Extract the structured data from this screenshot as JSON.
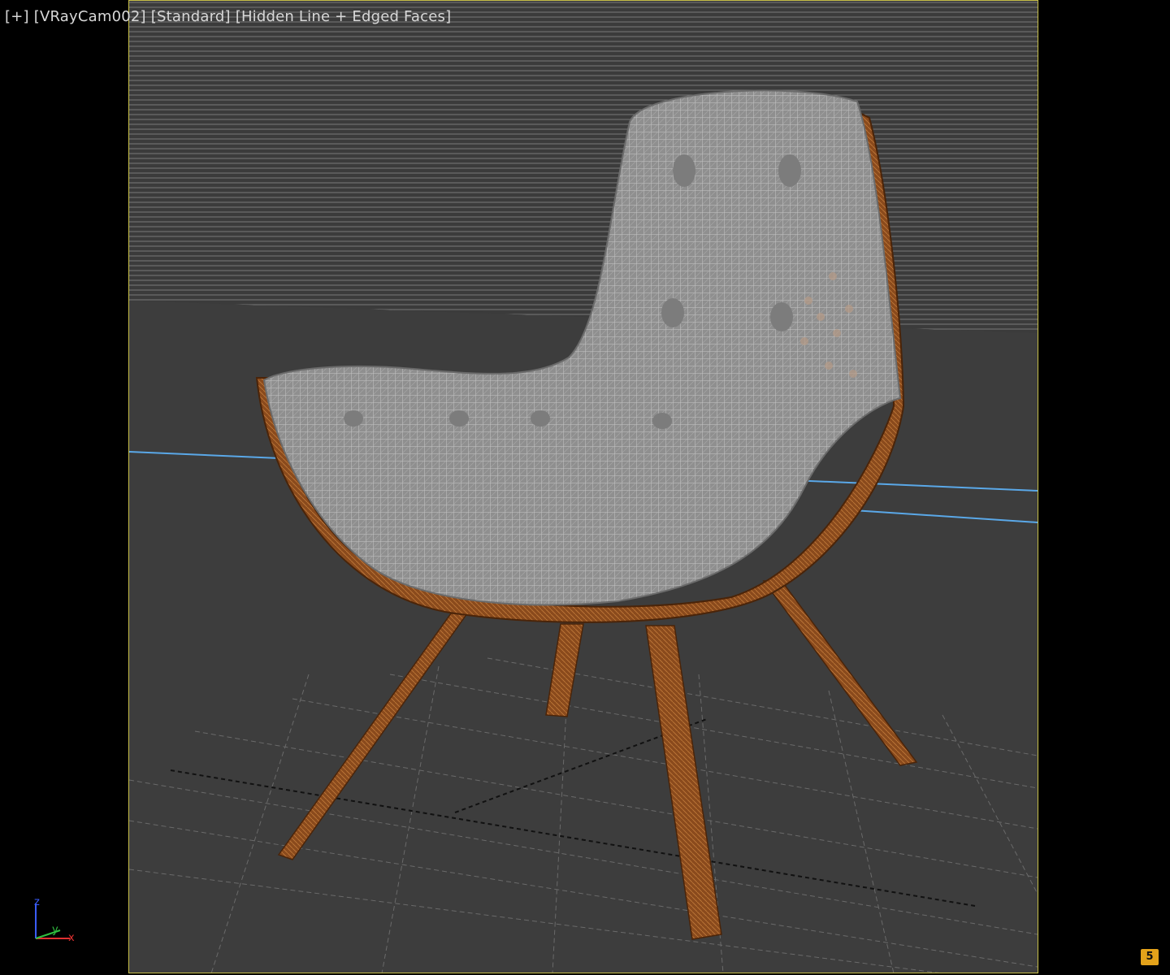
{
  "viewport": {
    "menu_plus": "[+]",
    "camera": "[VRayCam002]",
    "mode": "[Standard]",
    "shading": "[Hidden Line + Edged Faces]"
  },
  "gizmo": {
    "z": "z",
    "y": "y",
    "x": "x"
  },
  "badge": {
    "label": "5"
  },
  "colors": {
    "frame_border": "#c8c049",
    "background": "#000000",
    "viewport_bg": "#3a3a3a",
    "wood": "#8a4a1c",
    "wireframe": "#9a9a9a",
    "horizon_line": "#5aa8e8",
    "badge": "#e3a21a"
  }
}
